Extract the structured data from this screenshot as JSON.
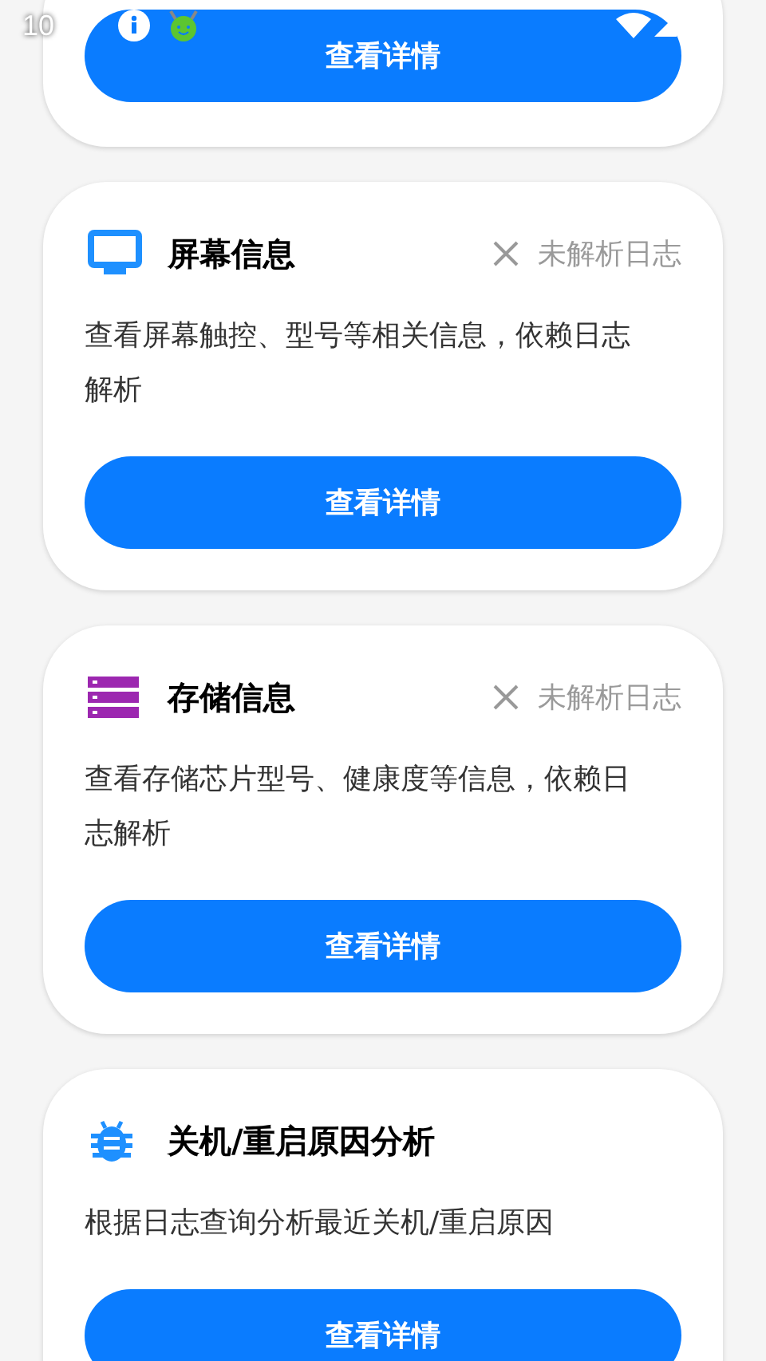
{
  "status_bar": {
    "time": "10"
  },
  "cards": [
    {
      "button": "查看详情"
    },
    {
      "kind": "screen",
      "title": "屏幕信息",
      "parse_status": "未解析日志",
      "description": "查看屏幕触控、型号等相关信息，依赖日志解析",
      "button": "查看详情"
    },
    {
      "kind": "storage",
      "title": "存储信息",
      "parse_status": "未解析日志",
      "description": "查看存储芯片型号、健康度等信息，依赖日志解析",
      "button": "查看详情"
    },
    {
      "kind": "bug",
      "title": "关机/重启原因分析",
      "description": "根据日志查询分析最近关机/重启原因",
      "button": "查看详情"
    }
  ]
}
